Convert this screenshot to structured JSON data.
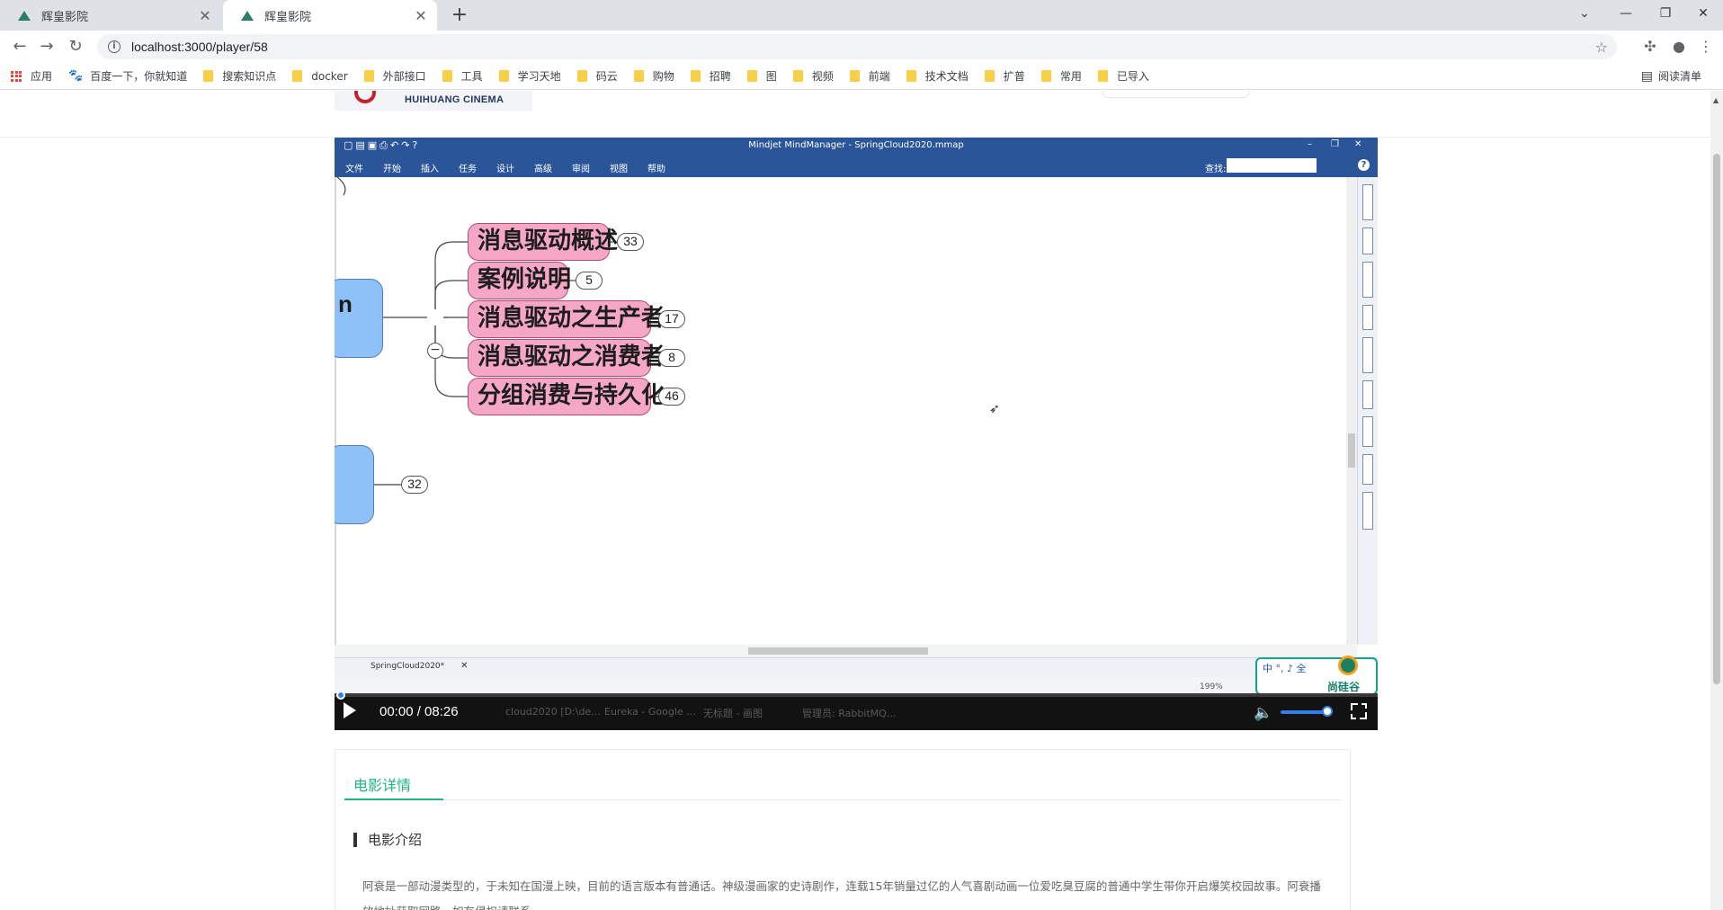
{
  "browser": {
    "tabs": [
      {
        "title": "辉皇影院",
        "active": false
      },
      {
        "title": "辉皇影院",
        "active": true
      }
    ],
    "url": "localhost:3000/player/58",
    "bookmarks": [
      "应用",
      "百度一下，你就知道",
      "搜索知识点",
      "docker",
      "外部接口",
      "工具",
      "学习天地",
      "码云",
      "购物",
      "招聘",
      "图",
      "视频",
      "前端",
      "技术文档",
      "扩普",
      "常用",
      "已导入"
    ],
    "reading_list": "阅读清单"
  },
  "site": {
    "logo_text": "HUIHUANG CINEMA"
  },
  "mindmanager": {
    "window_title": "Mindjet MindManager - SpringCloud2020.mmap",
    "menu": [
      "文件",
      "开始",
      "插入",
      "任务",
      "设计",
      "高级",
      "审阅",
      "视图",
      "帮助"
    ],
    "search_label": "查找:",
    "root_letter": "n",
    "nodes": [
      {
        "label": "消息驱动概述",
        "count": "33"
      },
      {
        "label": "案例说明",
        "count": "5"
      },
      {
        "label": "消息驱动之生产者",
        "count": "17"
      },
      {
        "label": "消息驱动之消费者",
        "count": "8"
      },
      {
        "label": "分组消费与持久化",
        "count": "46"
      }
    ],
    "lower_count": "32",
    "doc_tab": "SpringCloud2020*",
    "zoom": "199%",
    "brand_left": "中 °, ♪ 全",
    "brand_name": "尚硅谷"
  },
  "player": {
    "time": "00:00 / 08:26",
    "progress": 0.0,
    "volume": 0.8,
    "taskbar_ghosts": [
      "cloud2020 [D:\\de...",
      "Eureka - Google ...",
      "无标题 - 画图",
      "管理员: RabbitMQ..."
    ]
  },
  "detail": {
    "tab_label": "电影详情",
    "intro_title": "电影介绍",
    "intro_text": "阿衰是一部动漫类型的，于未知在国漫上映，目前的语言版本有普通话。神级漫画家的史诗剧作，连载15年销量过亿的人气喜剧动画一位爱吃臭豆腐的普通中学生带你开启爆笑校园故事。阿衰播放地址获取网路，如有侵权请联系。"
  },
  "colors": {
    "accent": "#21b383",
    "mm_title_bar": "#2a5598",
    "node_pink": "#f7a7c6",
    "root_blue": "#8ec1f7",
    "progress_blue": "#2f80ed"
  }
}
